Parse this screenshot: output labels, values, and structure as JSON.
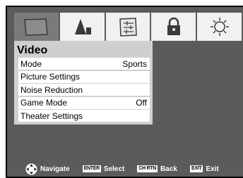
{
  "tabs": [
    {
      "icon": "picture-icon",
      "active": true
    },
    {
      "icon": "sound-icon",
      "active": false
    },
    {
      "icon": "settings-icon",
      "active": false
    },
    {
      "icon": "lock-icon",
      "active": false
    },
    {
      "icon": "setup-icon",
      "active": false
    }
  ],
  "panel": {
    "title": "Video",
    "items": [
      {
        "label": "Mode",
        "value": "Sports"
      },
      {
        "label": "Picture Settings",
        "value": ""
      },
      {
        "label": "Noise Reduction",
        "value": ""
      },
      {
        "label": "Game Mode",
        "value": "Off"
      },
      {
        "label": "Theater Settings",
        "value": ""
      }
    ]
  },
  "footer": {
    "navigate": {
      "label": "Navigate"
    },
    "select": {
      "key": "ENTER",
      "label": "Select"
    },
    "back": {
      "key": "CH RTN",
      "label": "Back"
    },
    "exit": {
      "key": "EXIT",
      "label": "Exit"
    }
  },
  "colors": {
    "background": "#5b5b5b",
    "panel": "#cfcfcf",
    "active_tab": "#7a7a7a",
    "tab": "#f1f1f1"
  }
}
